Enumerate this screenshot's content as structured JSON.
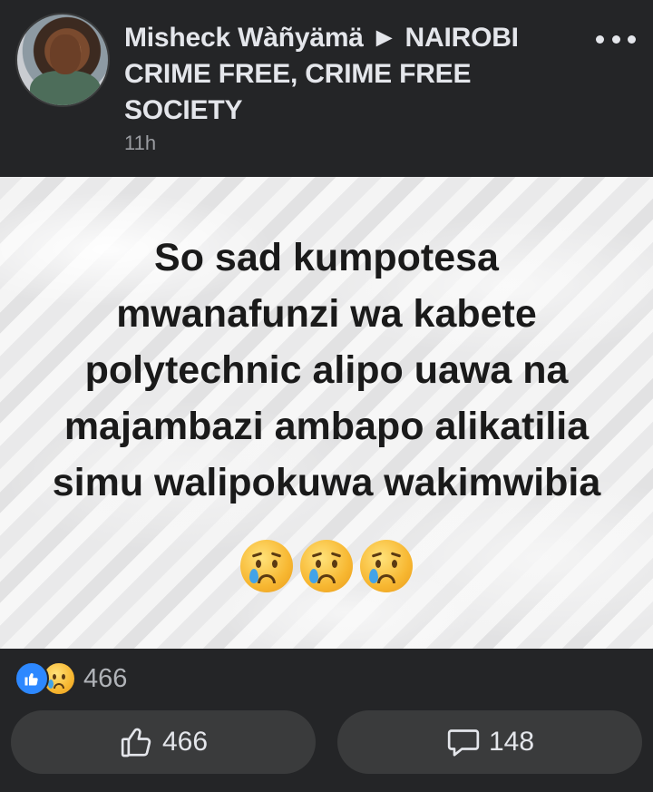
{
  "post": {
    "author_line": "Misheck Wàñyämä ► NAIROBI CRIME FREE, CRIME FREE SOCIETY",
    "time": "11h",
    "text_lines": [
      "So sad kumpotesa",
      "mwanafunzi wa kabete",
      "polytechnic alipo uawa na",
      "majambazi ambapo alikatilia",
      "simu walipokuwa wakimwibia"
    ],
    "emojis": [
      "crying-face",
      "crying-face",
      "crying-face"
    ]
  },
  "reactions": {
    "icons": [
      "like-icon",
      "sad-icon"
    ],
    "count": "466"
  },
  "actions": {
    "like_count": "466",
    "comment_count": "148"
  },
  "colors": {
    "background": "#242527",
    "button_bg": "#3a3b3c",
    "like_blue": "#2d88ff",
    "text": "#e4e6eb",
    "muted": "#9a9ca1"
  }
}
